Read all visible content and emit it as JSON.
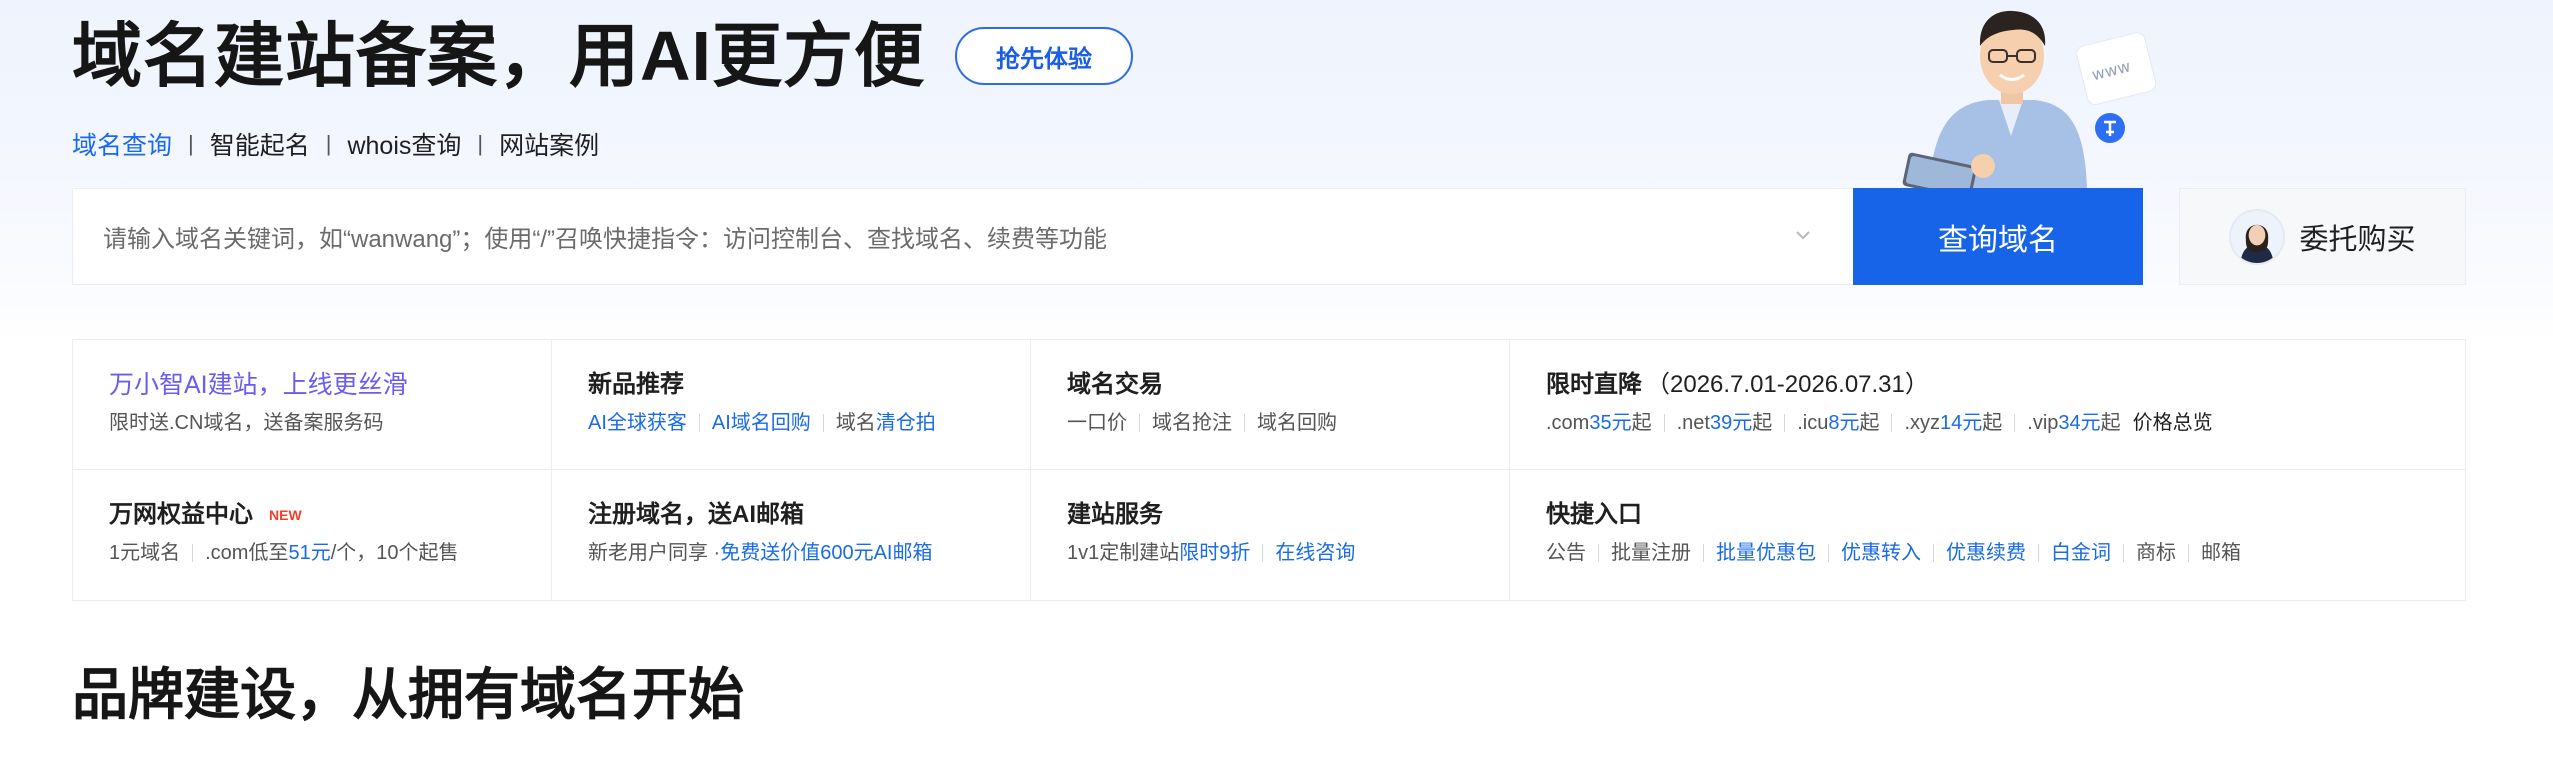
{
  "hero": {
    "title": "域名建站备案，用AI更方便",
    "try_button": "抢先体验"
  },
  "sub_nav": [
    {
      "label": "域名查询",
      "active": true
    },
    {
      "label": "智能起名",
      "active": false
    },
    {
      "label": "whois查询",
      "active": false
    },
    {
      "label": "网站案例",
      "active": false
    }
  ],
  "sub_nav_separator": "|",
  "search": {
    "placeholder": "请输入域名关键词，如“wanwang”；使用“/”召唤快捷指令：访问控制台、查找域名、续费等功能",
    "query_button": "查询域名",
    "entrust_button": "委托购买"
  },
  "cards": {
    "ai_site": {
      "title": "万小智AI建站，上线更丝滑",
      "sub": "限时送.CN域名，送备案服务码"
    },
    "new_products": {
      "title": "新品推荐",
      "links": [
        "AI全球获客",
        "AI域名回购"
      ],
      "last_prefix": "域名",
      "last_link": "清仓拍"
    },
    "domain_trade": {
      "title": "域名交易",
      "items": [
        "一口价",
        "域名抢注",
        "域名回购"
      ]
    },
    "price_drop": {
      "title": "限时直降",
      "period": "（2026.7.01-2026.07.31）",
      "prices": [
        {
          "tld": ".com",
          "price": "35元",
          "suffix": "起"
        },
        {
          "tld": ".net",
          "price": "39元",
          "suffix": "起"
        },
        {
          "tld": ".icu",
          "price": "8元",
          "suffix": "起"
        },
        {
          "tld": ".xyz",
          "price": "14元",
          "suffix": "起"
        },
        {
          "tld": ".vip",
          "price": "34元",
          "suffix": "起"
        }
      ],
      "overview": "价格总览"
    },
    "benefits": {
      "title": "万网权益中心",
      "tag": "NEW",
      "item1": "1元域名",
      "item2_prefix": ".com低至",
      "item2_price": "51元",
      "item2_suffix": "/个，10个起售"
    },
    "register": {
      "title": "注册域名，送AI邮箱",
      "prefix": "新老用户同享 · ",
      "link": "免费送价值600元AI邮箱"
    },
    "site_service": {
      "title": "建站服务",
      "prefix": "1v1定制建站",
      "highlight": "限时9折",
      "consult": "在线咨询"
    },
    "quick": {
      "title": "快捷入口",
      "items": [
        {
          "label": "公告",
          "blue": false
        },
        {
          "label": "批量注册",
          "blue": false
        },
        {
          "label": "批量优惠包",
          "blue": true
        },
        {
          "label": "优惠转入",
          "blue": true
        },
        {
          "label": "优惠续费",
          "blue": true
        },
        {
          "label": "白金词",
          "blue": true
        },
        {
          "label": "商标",
          "blue": false
        },
        {
          "label": "邮箱",
          "blue": false
        }
      ]
    }
  },
  "section_title": "品牌建设，从拥有域名开始",
  "colors": {
    "primary": "#1764e8",
    "link": "#1a6be8",
    "purple": "#6a5cf0",
    "new_tag": "#f0402a"
  }
}
